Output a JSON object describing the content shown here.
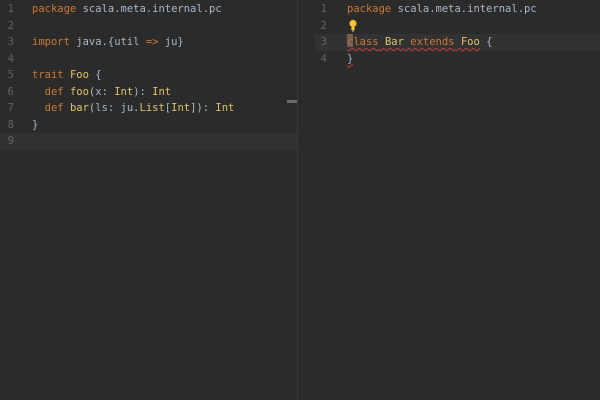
{
  "left_pane": {
    "lines": [
      {
        "number": "1",
        "tokens": [
          {
            "text": "package",
            "cls": "kw"
          },
          {
            "text": " scala.meta.internal.pc",
            "cls": "plain"
          }
        ]
      },
      {
        "number": "2",
        "tokens": []
      },
      {
        "number": "3",
        "tokens": [
          {
            "text": "import",
            "cls": "kw"
          },
          {
            "text": " java.{util ",
            "cls": "plain"
          },
          {
            "text": "=>",
            "cls": "kw"
          },
          {
            "text": " ju}",
            "cls": "plain"
          }
        ]
      },
      {
        "number": "4",
        "tokens": []
      },
      {
        "number": "5",
        "tokens": [
          {
            "text": "trait",
            "cls": "kw"
          },
          {
            "text": " ",
            "cls": "plain"
          },
          {
            "text": "Foo",
            "cls": "type"
          },
          {
            "text": " {",
            "cls": "plain"
          }
        ]
      },
      {
        "number": "6",
        "tokens": [
          {
            "text": "  ",
            "cls": "plain"
          },
          {
            "text": "def",
            "cls": "kw"
          },
          {
            "text": " ",
            "cls": "plain"
          },
          {
            "text": "foo",
            "cls": "fn"
          },
          {
            "text": "(x: ",
            "cls": "plain"
          },
          {
            "text": "Int",
            "cls": "type"
          },
          {
            "text": "): ",
            "cls": "plain"
          },
          {
            "text": "Int",
            "cls": "type"
          }
        ]
      },
      {
        "number": "7",
        "tokens": [
          {
            "text": "  ",
            "cls": "plain"
          },
          {
            "text": "def",
            "cls": "kw"
          },
          {
            "text": " ",
            "cls": "plain"
          },
          {
            "text": "bar",
            "cls": "fn"
          },
          {
            "text": "(ls: ju.",
            "cls": "plain"
          },
          {
            "text": "List",
            "cls": "type"
          },
          {
            "text": "[",
            "cls": "plain"
          },
          {
            "text": "Int",
            "cls": "type"
          },
          {
            "text": "]): ",
            "cls": "plain"
          },
          {
            "text": "Int",
            "cls": "type"
          }
        ]
      },
      {
        "number": "8",
        "tokens": [
          {
            "text": "}",
            "cls": "plain"
          }
        ]
      },
      {
        "number": "9",
        "current": true,
        "tokens": []
      }
    ]
  },
  "right_pane": {
    "lines": [
      {
        "number": "1",
        "tokens": [
          {
            "text": "package",
            "cls": "kw"
          },
          {
            "text": " scala.meta.internal.pc",
            "cls": "plain"
          }
        ]
      },
      {
        "number": "2",
        "bulb": true,
        "tokens": []
      },
      {
        "number": "3",
        "current": true,
        "caret": true,
        "tokens": [
          {
            "text": "class",
            "cls": "kw err-underline"
          },
          {
            "text": " ",
            "cls": "plain err-underline"
          },
          {
            "text": "Bar",
            "cls": "type err-underline"
          },
          {
            "text": " ",
            "cls": "plain err-underline"
          },
          {
            "text": "extends",
            "cls": "kw err-underline"
          },
          {
            "text": " ",
            "cls": "plain err-underline"
          },
          {
            "text": "Foo",
            "cls": "type err-underline"
          },
          {
            "text": " {",
            "cls": "plain"
          }
        ]
      },
      {
        "number": "4",
        "tokens": [
          {
            "text": "}",
            "cls": "plain err-underline"
          }
        ]
      }
    ]
  },
  "icons": {
    "intention_bulb": "lightbulb-icon",
    "bulb_color": "#f4c430"
  },
  "colors": {
    "background": "#2b2b2b",
    "current_line": "#323232",
    "keyword": "#cc7832",
    "type": "#e0c46c",
    "text": "#a9b7c6",
    "line_number": "#606366",
    "error_underline": "#bc3f3c"
  }
}
